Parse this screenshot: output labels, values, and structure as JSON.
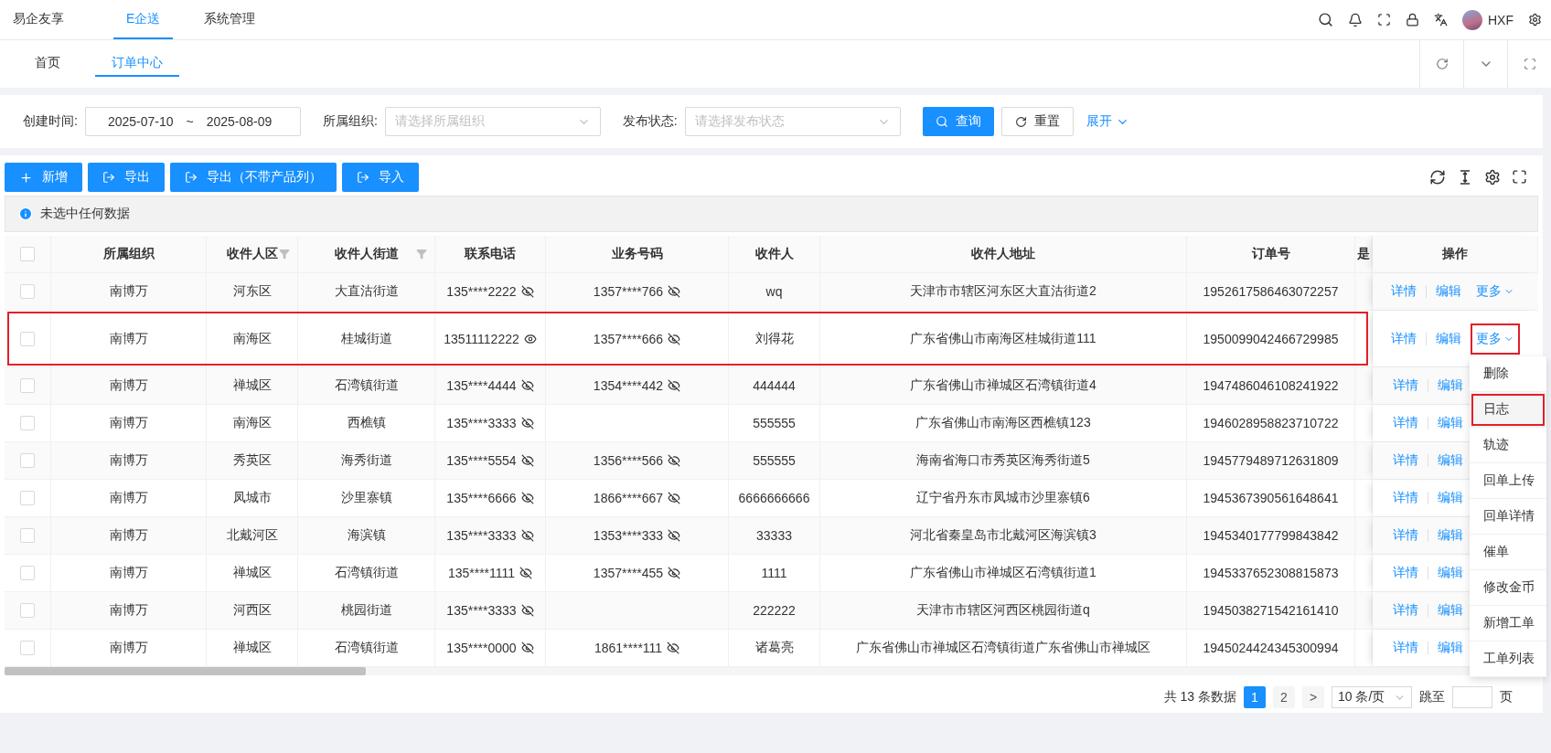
{
  "top_nav": {
    "tabs": [
      {
        "label": "易企友享",
        "selected": false
      },
      {
        "label": "E企送",
        "selected": true
      },
      {
        "label": "系统管理",
        "selected": false
      }
    ],
    "user": "HXF"
  },
  "page_tabs": [
    {
      "label": "首页",
      "selected": false
    },
    {
      "label": "订单中心",
      "selected": true
    }
  ],
  "filters": {
    "created_label": "创建时间:",
    "date_start": "2025-07-10",
    "date_sep": "~",
    "date_end": "2025-08-09",
    "org_label": "所属组织:",
    "org_placeholder": "请选择所属组织",
    "status_label": "发布状态:",
    "status_placeholder": "请选择发布状态",
    "search_button": "查询",
    "reset_button": "重置",
    "expand_link": "展开"
  },
  "toolbar": [
    {
      "label": "新增",
      "kind": "add"
    },
    {
      "label": "导出",
      "kind": "export"
    },
    {
      "label": "导出（不带产品列）",
      "kind": "export"
    },
    {
      "label": "导入",
      "kind": "export"
    }
  ],
  "alert": "未选中任何数据",
  "table": {
    "select_all": {
      "checked": false
    },
    "columns": [
      {
        "label": "所属组织",
        "filter": false
      },
      {
        "label": "收件人区",
        "filter": true
      },
      {
        "label": "收件人街道",
        "filter": true
      },
      {
        "label": "联系电话",
        "filter": false
      },
      {
        "label": "业务号码",
        "filter": false
      },
      {
        "label": "收件人",
        "filter": false
      },
      {
        "label": "收件人地址",
        "filter": false
      },
      {
        "label": "订单号",
        "filter": false
      },
      {
        "label": "是",
        "filter": false
      },
      {
        "label": "操作",
        "filter": false
      }
    ],
    "rows": [
      {
        "checked": false,
        "highlighted": false,
        "org": "南博万",
        "district": "河东区",
        "street": "大直沽街道",
        "phone": {
          "text": "135****2222",
          "masked": true
        },
        "business_no": {
          "text": "1357****766",
          "masked": true
        },
        "recipient": "wq",
        "address": "天津市市辖区河东区大直沽街道2",
        "order_no": "1952617586463072257",
        "actions": [
          "详情",
          "编辑"
        ],
        "more": {
          "label": "更多",
          "highlighted": false
        }
      },
      {
        "checked": false,
        "highlighted": true,
        "org": "南博万",
        "district": "南海区",
        "street": "桂城街道",
        "phone": {
          "text": "13511112222",
          "masked": false
        },
        "business_no": {
          "text": "1357****666",
          "masked": true
        },
        "recipient": "刘得花",
        "address": "广东省佛山市南海区桂城街道111",
        "order_no": "1950099042466729985",
        "actions": [
          "详情",
          "编辑"
        ],
        "more": {
          "label": "更多",
          "highlighted": true
        }
      },
      {
        "checked": false,
        "highlighted": false,
        "org": "南博万",
        "district": "禅城区",
        "street": "石湾镇街道",
        "phone": {
          "text": "135****4444",
          "masked": true
        },
        "business_no": {
          "text": "1354****442",
          "masked": true
        },
        "recipient": "444444",
        "address": "广东省佛山市禅城区石湾镇街道4",
        "order_no": "1947486046108241922",
        "actions": [
          "详情",
          "编辑"
        ]
      },
      {
        "checked": false,
        "highlighted": false,
        "org": "南博万",
        "district": "南海区",
        "street": "西樵镇",
        "phone": {
          "text": "135****3333",
          "masked": true
        },
        "recipient": "555555",
        "address": "广东省佛山市南海区西樵镇123",
        "order_no": "1946028958823710722",
        "actions": [
          "详情",
          "编辑"
        ]
      },
      {
        "checked": false,
        "highlighted": false,
        "org": "南博万",
        "district": "秀英区",
        "street": "海秀街道",
        "phone": {
          "text": "135****5554",
          "masked": true
        },
        "business_no": {
          "text": "1356****566",
          "masked": true
        },
        "recipient": "555555",
        "address": "海南省海口市秀英区海秀街道5",
        "order_no": "1945779489712631809",
        "actions": [
          "详情",
          "编辑"
        ]
      },
      {
        "checked": false,
        "highlighted": false,
        "org": "南博万",
        "district": "凤城市",
        "street": "沙里寨镇",
        "phone": {
          "text": "135****6666",
          "masked": true
        },
        "business_no": {
          "text": "1866****667",
          "masked": true
        },
        "recipient": "6666666666",
        "address": "辽宁省丹东市凤城市沙里寨镇6",
        "order_no": "1945367390561648641",
        "actions": [
          "详情",
          "编辑"
        ]
      },
      {
        "checked": false,
        "highlighted": false,
        "org": "南博万",
        "district": "北戴河区",
        "street": "海滨镇",
        "phone": {
          "text": "135****3333",
          "masked": true
        },
        "business_no": {
          "text": "1353****333",
          "masked": true
        },
        "recipient": "33333",
        "address": "河北省秦皇岛市北戴河区海滨镇3",
        "order_no": "1945340177799843842",
        "actions": [
          "详情",
          "编辑"
        ]
      },
      {
        "checked": false,
        "highlighted": false,
        "org": "南博万",
        "district": "禅城区",
        "street": "石湾镇街道",
        "phone": {
          "text": "135****1111",
          "masked": true
        },
        "business_no": {
          "text": "1357****455",
          "masked": true
        },
        "recipient": "1111",
        "address": "广东省佛山市禅城区石湾镇街道1",
        "order_no": "1945337652308815873",
        "actions": [
          "详情",
          "编辑"
        ]
      },
      {
        "checked": false,
        "highlighted": false,
        "org": "南博万",
        "district": "河西区",
        "street": "桃园街道",
        "phone": {
          "text": "135****3333",
          "masked": true
        },
        "recipient": "222222",
        "address": "天津市市辖区河西区桃园街道q",
        "order_no": "1945038271542161410",
        "actions": [
          "详情",
          "编辑"
        ]
      },
      {
        "checked": false,
        "highlighted": false,
        "org": "南博万",
        "district": "禅城区",
        "street": "石湾镇街道",
        "phone": {
          "text": "135****0000",
          "masked": true
        },
        "business_no": {
          "text": "1861****111",
          "masked": true
        },
        "recipient": "诸葛亮",
        "address": "广东省佛山市禅城区石湾镇街道广东省佛山市禅城区",
        "order_no": "1945024424345300994",
        "actions": [
          "详情",
          "编辑"
        ]
      }
    ]
  },
  "more_menu": [
    {
      "label": "删除",
      "highlighted": false
    },
    {
      "label": "日志",
      "highlighted": true
    },
    {
      "label": "轨迹",
      "highlighted": false
    },
    {
      "label": "回单上传",
      "highlighted": false
    },
    {
      "label": "回单详情",
      "highlighted": false
    },
    {
      "label": "催单",
      "highlighted": false
    },
    {
      "label": "修改金币",
      "highlighted": false
    },
    {
      "label": "新增工单",
      "highlighted": false
    },
    {
      "label": "工单列表",
      "highlighted": false
    }
  ],
  "pagination": {
    "total": "共 13 条数据",
    "pages": [
      {
        "label": "1",
        "selected": true
      },
      {
        "label": "2",
        "selected": false
      }
    ],
    "next": ">",
    "page_size": "10 条/页",
    "jump_label": "跳至",
    "jump_suffix": "页"
  }
}
